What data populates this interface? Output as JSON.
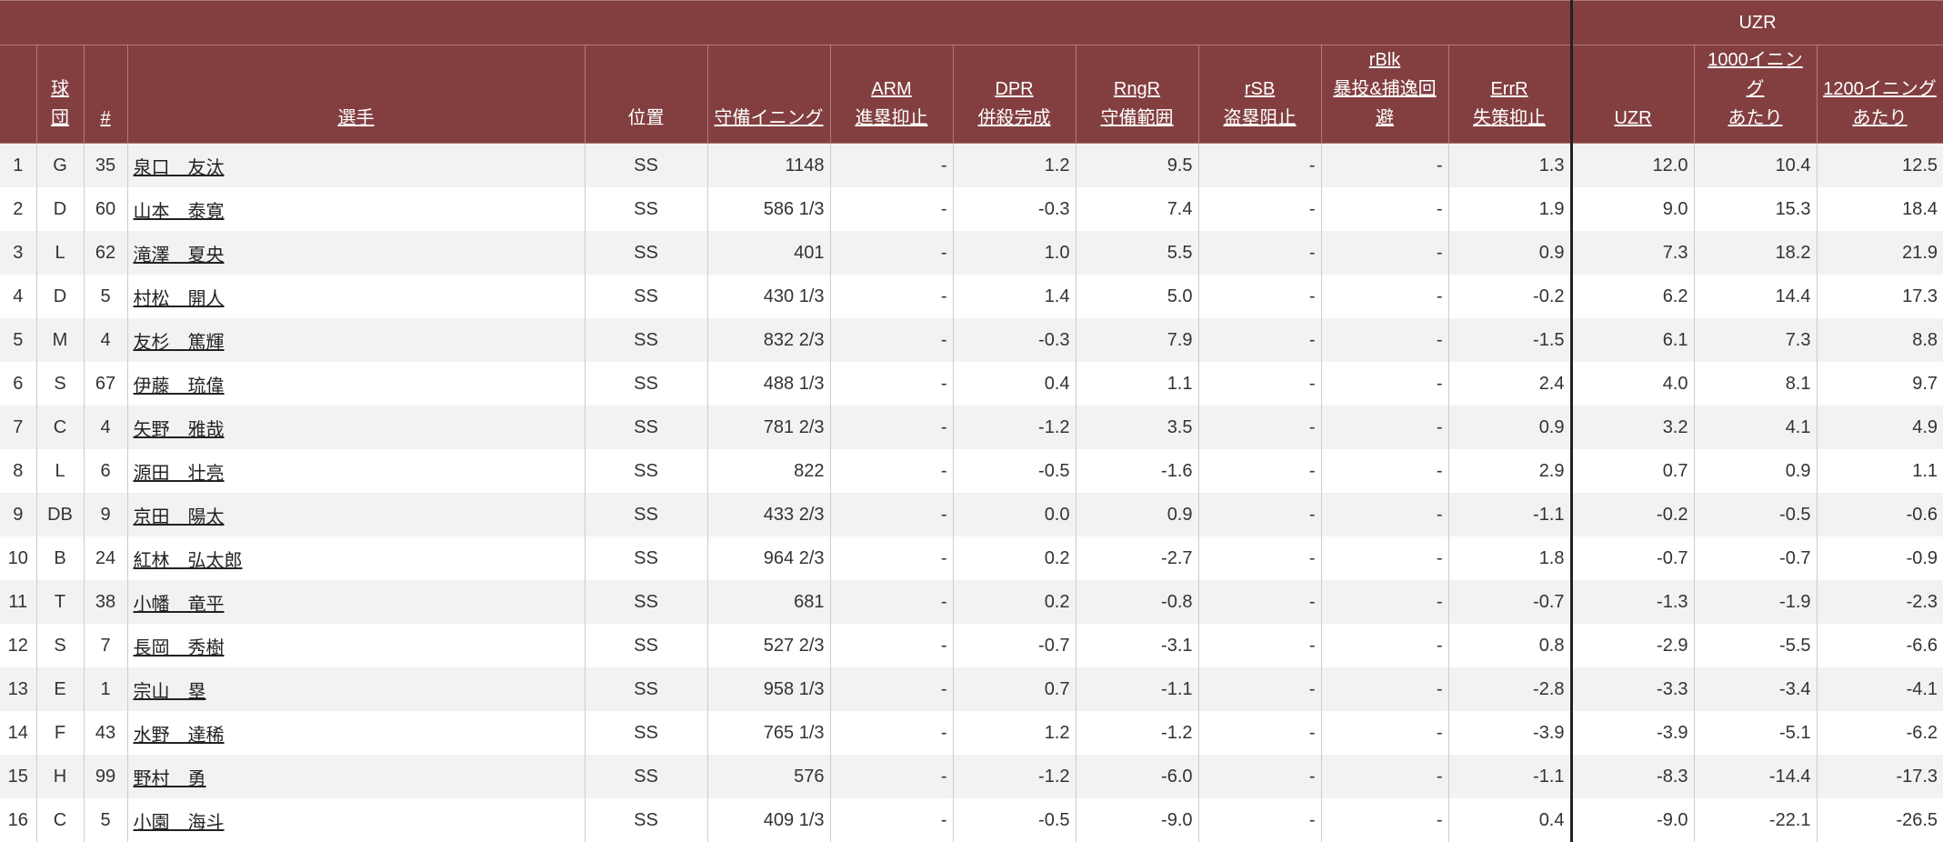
{
  "headers": {
    "team": "球団",
    "number": "#",
    "player": "選手",
    "position": "位置",
    "innings": "守備イニング",
    "arm": [
      "ARM",
      "進塁抑止"
    ],
    "dpr": [
      "DPR",
      "併殺完成"
    ],
    "rngr": [
      "RngR",
      "守備範囲"
    ],
    "rsb": [
      "rSB",
      "盗塁阻止"
    ],
    "rblk": [
      "rBlk",
      "暴投&捕逸回避"
    ],
    "errr": [
      "ErrR",
      "失策抑止"
    ],
    "uzr_group": "UZR",
    "uzr": "UZR",
    "per1000": [
      "1000イニング",
      "あたり"
    ],
    "per1200": [
      "1200イニング",
      "あたり"
    ]
  },
  "rows": [
    {
      "rank": "1",
      "team": "G",
      "num": "35",
      "player": "泉口　友汰",
      "pos": "SS",
      "inn": "1148",
      "arm": "-",
      "dpr": "1.2",
      "rngr": "9.5",
      "rsb": "-",
      "rblk": "-",
      "errr": "1.3",
      "uzr": "12.0",
      "p1000": "10.4",
      "p1200": "12.5"
    },
    {
      "rank": "2",
      "team": "D",
      "num": "60",
      "player": "山本　泰寛",
      "pos": "SS",
      "inn": "586 1/3",
      "arm": "-",
      "dpr": "-0.3",
      "rngr": "7.4",
      "rsb": "-",
      "rblk": "-",
      "errr": "1.9",
      "uzr": "9.0",
      "p1000": "15.3",
      "p1200": "18.4"
    },
    {
      "rank": "3",
      "team": "L",
      "num": "62",
      "player": "滝澤　夏央",
      "pos": "SS",
      "inn": "401",
      "arm": "-",
      "dpr": "1.0",
      "rngr": "5.5",
      "rsb": "-",
      "rblk": "-",
      "errr": "0.9",
      "uzr": "7.3",
      "p1000": "18.2",
      "p1200": "21.9"
    },
    {
      "rank": "4",
      "team": "D",
      "num": "5",
      "player": "村松　開人",
      "pos": "SS",
      "inn": "430 1/3",
      "arm": "-",
      "dpr": "1.4",
      "rngr": "5.0",
      "rsb": "-",
      "rblk": "-",
      "errr": "-0.2",
      "uzr": "6.2",
      "p1000": "14.4",
      "p1200": "17.3"
    },
    {
      "rank": "5",
      "team": "M",
      "num": "4",
      "player": "友杉　篤輝",
      "pos": "SS",
      "inn": "832 2/3",
      "arm": "-",
      "dpr": "-0.3",
      "rngr": "7.9",
      "rsb": "-",
      "rblk": "-",
      "errr": "-1.5",
      "uzr": "6.1",
      "p1000": "7.3",
      "p1200": "8.8"
    },
    {
      "rank": "6",
      "team": "S",
      "num": "67",
      "player": "伊藤　琉偉",
      "pos": "SS",
      "inn": "488 1/3",
      "arm": "-",
      "dpr": "0.4",
      "rngr": "1.1",
      "rsb": "-",
      "rblk": "-",
      "errr": "2.4",
      "uzr": "4.0",
      "p1000": "8.1",
      "p1200": "9.7"
    },
    {
      "rank": "7",
      "team": "C",
      "num": "4",
      "player": "矢野　雅哉",
      "pos": "SS",
      "inn": "781 2/3",
      "arm": "-",
      "dpr": "-1.2",
      "rngr": "3.5",
      "rsb": "-",
      "rblk": "-",
      "errr": "0.9",
      "uzr": "3.2",
      "p1000": "4.1",
      "p1200": "4.9"
    },
    {
      "rank": "8",
      "team": "L",
      "num": "6",
      "player": "源田　壮亮",
      "pos": "SS",
      "inn": "822",
      "arm": "-",
      "dpr": "-0.5",
      "rngr": "-1.6",
      "rsb": "-",
      "rblk": "-",
      "errr": "2.9",
      "uzr": "0.7",
      "p1000": "0.9",
      "p1200": "1.1"
    },
    {
      "rank": "9",
      "team": "DB",
      "num": "9",
      "player": "京田　陽太",
      "pos": "SS",
      "inn": "433 2/3",
      "arm": "-",
      "dpr": "0.0",
      "rngr": "0.9",
      "rsb": "-",
      "rblk": "-",
      "errr": "-1.1",
      "uzr": "-0.2",
      "p1000": "-0.5",
      "p1200": "-0.6"
    },
    {
      "rank": "10",
      "team": "B",
      "num": "24",
      "player": "紅林　弘太郎",
      "pos": "SS",
      "inn": "964 2/3",
      "arm": "-",
      "dpr": "0.2",
      "rngr": "-2.7",
      "rsb": "-",
      "rblk": "-",
      "errr": "1.8",
      "uzr": "-0.7",
      "p1000": "-0.7",
      "p1200": "-0.9"
    },
    {
      "rank": "11",
      "team": "T",
      "num": "38",
      "player": "小幡　竜平",
      "pos": "SS",
      "inn": "681",
      "arm": "-",
      "dpr": "0.2",
      "rngr": "-0.8",
      "rsb": "-",
      "rblk": "-",
      "errr": "-0.7",
      "uzr": "-1.3",
      "p1000": "-1.9",
      "p1200": "-2.3"
    },
    {
      "rank": "12",
      "team": "S",
      "num": "7",
      "player": "長岡　秀樹",
      "pos": "SS",
      "inn": "527 2/3",
      "arm": "-",
      "dpr": "-0.7",
      "rngr": "-3.1",
      "rsb": "-",
      "rblk": "-",
      "errr": "0.8",
      "uzr": "-2.9",
      "p1000": "-5.5",
      "p1200": "-6.6"
    },
    {
      "rank": "13",
      "team": "E",
      "num": "1",
      "player": "宗山　塁",
      "pos": "SS",
      "inn": "958 1/3",
      "arm": "-",
      "dpr": "0.7",
      "rngr": "-1.1",
      "rsb": "-",
      "rblk": "-",
      "errr": "-2.8",
      "uzr": "-3.3",
      "p1000": "-3.4",
      "p1200": "-4.1"
    },
    {
      "rank": "14",
      "team": "F",
      "num": "43",
      "player": "水野　達稀",
      "pos": "SS",
      "inn": "765 1/3",
      "arm": "-",
      "dpr": "1.2",
      "rngr": "-1.2",
      "rsb": "-",
      "rblk": "-",
      "errr": "-3.9",
      "uzr": "-3.9",
      "p1000": "-5.1",
      "p1200": "-6.2"
    },
    {
      "rank": "15",
      "team": "H",
      "num": "99",
      "player": "野村　勇",
      "pos": "SS",
      "inn": "576",
      "arm": "-",
      "dpr": "-1.2",
      "rngr": "-6.0",
      "rsb": "-",
      "rblk": "-",
      "errr": "-1.1",
      "uzr": "-8.3",
      "p1000": "-14.4",
      "p1200": "-17.3"
    },
    {
      "rank": "16",
      "team": "C",
      "num": "5",
      "player": "小園　海斗",
      "pos": "SS",
      "inn": "409 1/3",
      "arm": "-",
      "dpr": "-0.5",
      "rngr": "-9.0",
      "rsb": "-",
      "rblk": "-",
      "errr": "0.4",
      "uzr": "-9.0",
      "p1000": "-22.1",
      "p1200": "-26.5"
    }
  ]
}
